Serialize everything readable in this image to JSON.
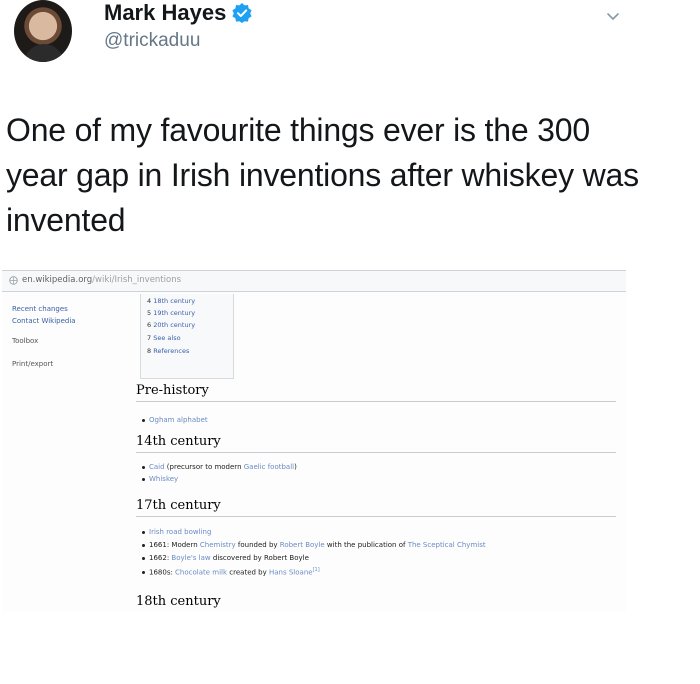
{
  "tweet": {
    "name": "Mark Hayes",
    "handle": "@trickaduu",
    "text": "One of my favourite things ever is the 300 year gap in Irish inventions after whiskey was invented"
  },
  "browser": {
    "url_domain": "en.wikipedia.org",
    "url_path": "/wiki/Irish_inventions"
  },
  "sidebar": [
    "Recent changes",
    "Contact Wikipedia",
    "Toolbox",
    "Print/export"
  ],
  "toc": [
    {
      "num": "4",
      "label": "18th century"
    },
    {
      "num": "5",
      "label": "19th century"
    },
    {
      "num": "6",
      "label": "20th century"
    },
    {
      "num": "7",
      "label": "See also"
    },
    {
      "num": "8",
      "label": "References"
    }
  ],
  "sections": {
    "prehistory": {
      "heading": "Pre-history",
      "items": [
        "Ogham alphabet"
      ]
    },
    "c14": {
      "heading": "14th century",
      "item1_link": "Caid",
      "item1_text": " (precursor to modern ",
      "item1_link2": "Gaelic football",
      "item1_end": ")",
      "item2": "Whiskey"
    },
    "c17": {
      "heading": "17th century",
      "i1": "Irish road bowling",
      "i2_a": "1661: Modern ",
      "i2_l1": "Chemistry",
      "i2_b": " founded by ",
      "i2_l2": "Robert Boyle",
      "i2_c": " with the publication of ",
      "i2_l3": "The Sceptical Chymist",
      "i3_a": "1662: ",
      "i3_l1": "Boyle's law",
      "i3_b": " discovered by Robert Boyle",
      "i4_a": "1680s: ",
      "i4_l1": "Chocolate milk",
      "i4_b": " created by ",
      "i4_l2": "Hans Sloane",
      "i4_sup": "[1]"
    },
    "c18": {
      "heading": "18th century"
    }
  }
}
